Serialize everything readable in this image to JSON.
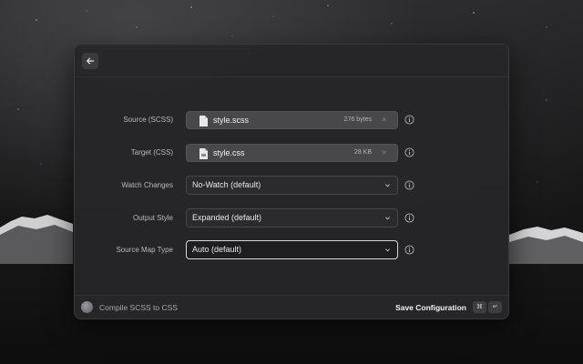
{
  "colors": {
    "window_bg": "#262628",
    "field_bg": "#48484b",
    "select_bg": "#2b2b2d",
    "focus_border": "#d7d7da",
    "text_primary": "#f2f2f4",
    "text_secondary": "#b9b9bd"
  },
  "header": {
    "back_icon": "arrow-left-icon"
  },
  "form": {
    "source": {
      "label": "Source (SCSS)",
      "file_name": "style.scss",
      "file_size": "276 bytes",
      "clear_glyph": "×",
      "icon": "file-icon"
    },
    "target": {
      "label": "Target (CSS)",
      "file_name": "style.css",
      "file_size": "28 KB",
      "clear_glyph": "×",
      "icon": "css-file-icon"
    },
    "watch": {
      "label": "Watch Changes",
      "value": "No-Watch (default)"
    },
    "output_style": {
      "label": "Output Style",
      "value": "Expanded (default)"
    },
    "source_map": {
      "label": "Source Map Type",
      "value": "Auto (default)"
    }
  },
  "footer": {
    "title": "Compile SCSS to CSS",
    "primary_action": "Save Configuration",
    "shortcut_cmd": "⌘",
    "shortcut_return": "↵"
  }
}
